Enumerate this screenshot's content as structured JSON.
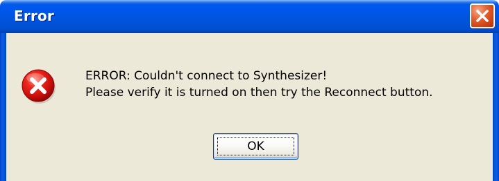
{
  "window": {
    "title": "Error",
    "close_icon": "close-icon"
  },
  "dialog": {
    "icon": "error-icon",
    "message_line1": "ERROR: Couldn't connect to Synthesizer!",
    "message_line2": "Please verify it is turned on then try the Reconnect button.",
    "ok_label": "OK"
  },
  "colors": {
    "titlebar": "#0055e5",
    "body": "#ece9d8",
    "close_button": "#d9531e",
    "error_icon": "#d7130f"
  }
}
